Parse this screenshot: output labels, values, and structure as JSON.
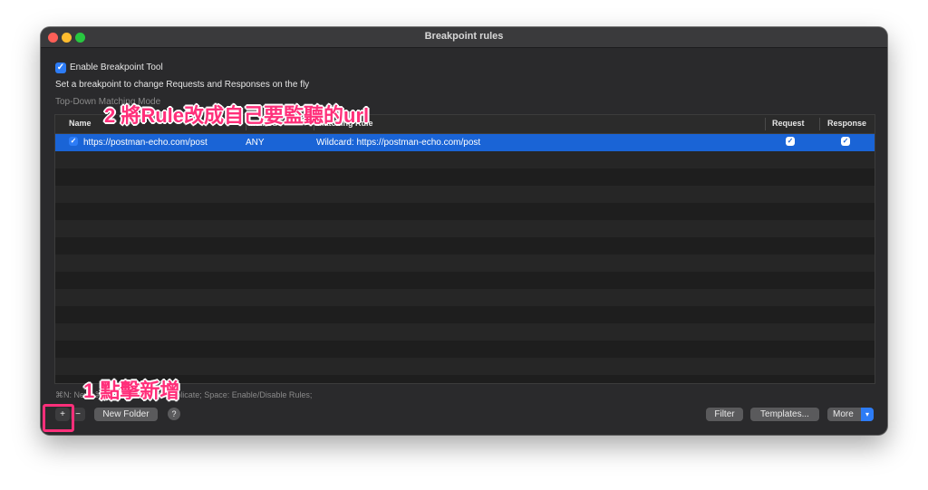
{
  "window": {
    "title": "Breakpoint rules"
  },
  "enable": {
    "checked": true,
    "label": "Enable Breakpoint Tool"
  },
  "description": "Set a breakpoint to change Requests and Responses on the fly",
  "matching_mode": "Top-Down Matching Mode",
  "table": {
    "columns": [
      "Name",
      "Method",
      "Matching Rule",
      "Request",
      "Response"
    ],
    "rows": [
      {
        "enabled": true,
        "name": "https://postman-echo.com/post",
        "method": "ANY",
        "matching_rule": "Wildcard: https://postman-echo.com/post",
        "request": true,
        "response": true,
        "selected": true
      }
    ]
  },
  "shortcuts": "⌘N: New; ⌘⌫: Delete; ⌘D: Duplicate; Space: Enable/Disable Rules;",
  "buttons": {
    "add": "+",
    "remove": "−",
    "new_folder": "New Folder",
    "help": "?",
    "filter": "Filter",
    "templates": "Templates...",
    "more": "More"
  },
  "annotations": {
    "step2": "2 將Rule改成自己要監聽的url",
    "step1": "1 點擊新增"
  },
  "colors": {
    "accent": "#2d7cf6",
    "selection": "#1a64d6",
    "annotation": "#ff2f7a"
  }
}
